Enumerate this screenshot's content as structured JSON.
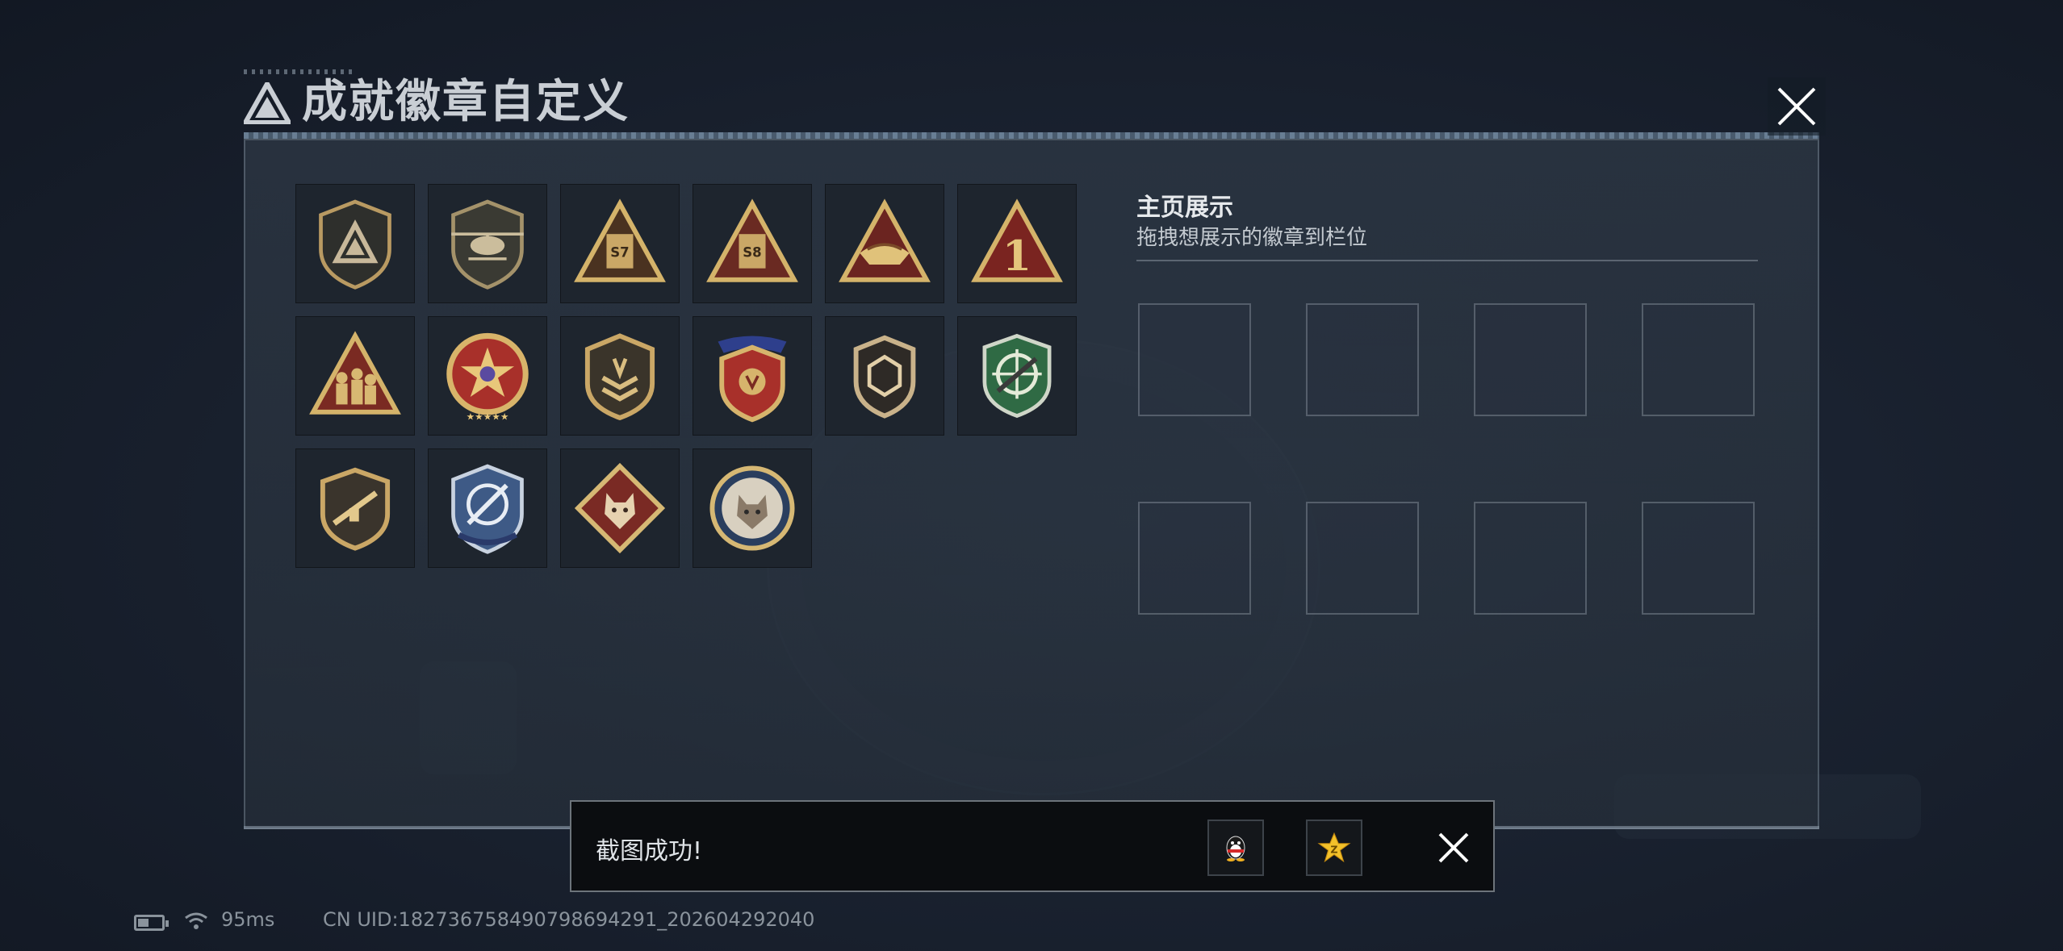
{
  "header": {
    "title": "成就徽章自定义",
    "close_icon": "close-icon"
  },
  "colors": {
    "accent": "#c9a45a",
    "panel_bg": "#2d3744",
    "toast_bg": "#0b0d10",
    "text": "#d8dde3"
  },
  "badges": [
    {
      "icon": "triangle-logo-shield-badge"
    },
    {
      "icon": "helicopter-shield-badge"
    },
    {
      "icon": "season-s7-triangle-badge",
      "label": "S7"
    },
    {
      "icon": "season-s8-triangle-badge",
      "label": "S8"
    },
    {
      "icon": "boat-triangle-badge"
    },
    {
      "icon": "number-one-triangle-badge",
      "label": "1"
    },
    {
      "icon": "soldiers-triangle-badge"
    },
    {
      "icon": "star-medal-badge"
    },
    {
      "icon": "chevron-shield-badge"
    },
    {
      "icon": "wings-ribbon-shield-badge"
    },
    {
      "icon": "hexagon-shield-badge"
    },
    {
      "icon": "green-crosshair-rifle-badge"
    },
    {
      "icon": "rifle-shield-badge"
    },
    {
      "icon": "crosshair-knife-shield-badge"
    },
    {
      "icon": "wolf-diamond-badge"
    },
    {
      "icon": "wolf-circle-badge"
    }
  ],
  "showcase": {
    "title": "主页展示",
    "subtitle": "拖拽想展示的徽章到栏位",
    "slot_count": 8
  },
  "toast": {
    "text": "截图成功!",
    "buttons": [
      {
        "icon": "qq-penguin-icon"
      },
      {
        "icon": "star-z-icon"
      }
    ],
    "close_icon": "close-icon"
  },
  "status": {
    "battery_icon": "battery-icon",
    "wifi_icon": "wifi-icon",
    "ping": "95ms",
    "uid": "CN UID:18273675849079869429​1_202604292040"
  }
}
